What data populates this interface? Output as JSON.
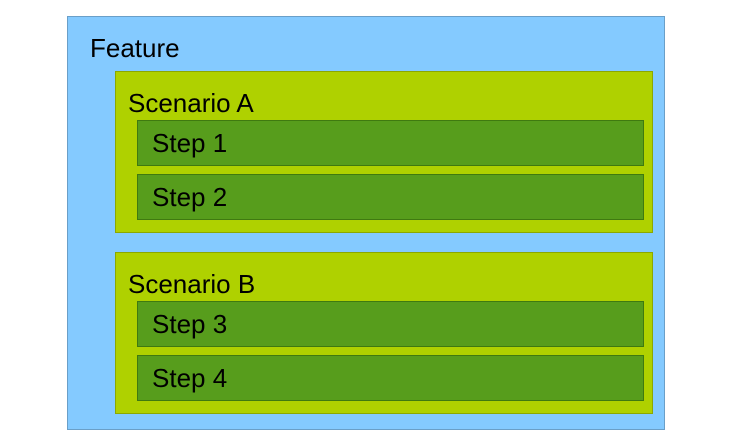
{
  "feature": {
    "label": "Feature",
    "scenarios": [
      {
        "label": "Scenario A",
        "steps": [
          {
            "label": "Step 1"
          },
          {
            "label": "Step 2"
          }
        ]
      },
      {
        "label": "Scenario B",
        "steps": [
          {
            "label": "Step 3"
          },
          {
            "label": "Step 4"
          }
        ]
      }
    ]
  },
  "colors": {
    "feature_fill": "#84caff",
    "scenario_fill": "#afd100",
    "step_fill": "#579d1c"
  }
}
